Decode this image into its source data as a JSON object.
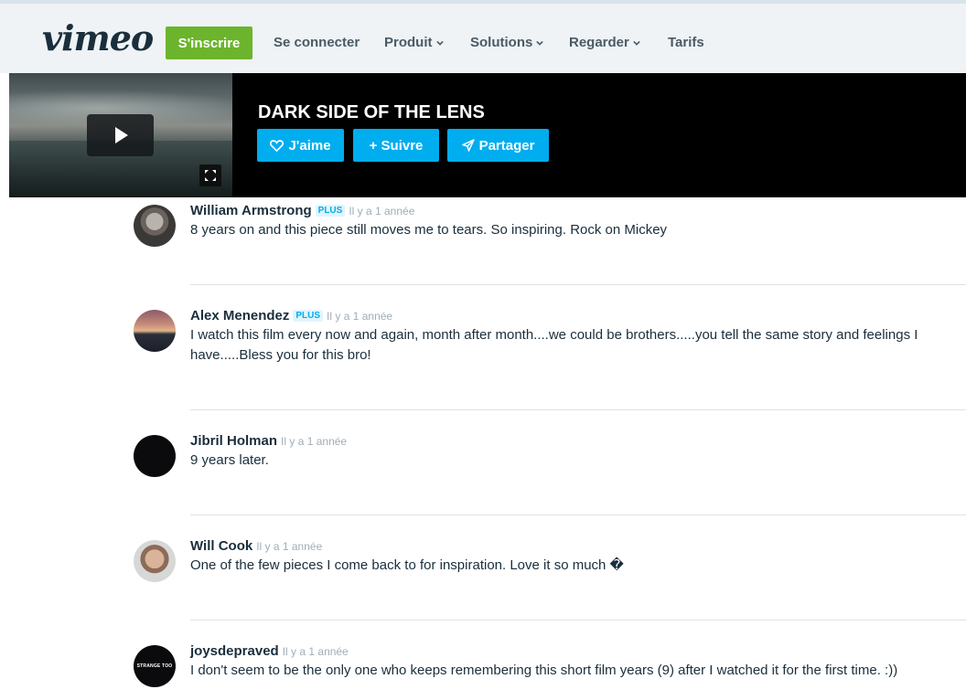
{
  "nav": {
    "logo": "vimeo",
    "signup": "S'inscrire",
    "login": "Se connecter",
    "product": "Produit",
    "solutions": "Solutions",
    "watch": "Regarder",
    "pricing": "Tarifs"
  },
  "video": {
    "title": "DARK SIDE OF THE LENS",
    "like": "J'aime",
    "follow": "+ Suivre",
    "share": "Partager"
  },
  "colors": {
    "brand_green": "#6cb42c",
    "accent_blue": "#00adef",
    "text": "#1a2e3b"
  },
  "comments": [
    {
      "author": "William Armstrong",
      "badge": "PLUS",
      "time": "Il y a 1 année",
      "text": "8 years on and this piece still moves me to tears. So inspiring. Rock on Mickey"
    },
    {
      "author": "Alex Menendez",
      "badge": "PLUS",
      "time": "Il y a 1 année",
      "text": "I watch this film every now and again, month after month....we could be brothers.....you tell the same story and feelings I have.....Bless you for this bro!"
    },
    {
      "author": "Jibril Holman",
      "time": "Il y a 1 année",
      "text": "9 years later."
    },
    {
      "author": "Will Cook",
      "time": "Il y a 1 année",
      "text": "One of the few pieces I come back to for inspiration. Love it so much �"
    },
    {
      "author": "joysdepraved",
      "time": "Il y a 1 année",
      "text": "I don't seem to be the only one who keeps remembering this short film years (9) after I watched it for the first time. :))",
      "avatar_text": "STRANGE TOO"
    }
  ]
}
